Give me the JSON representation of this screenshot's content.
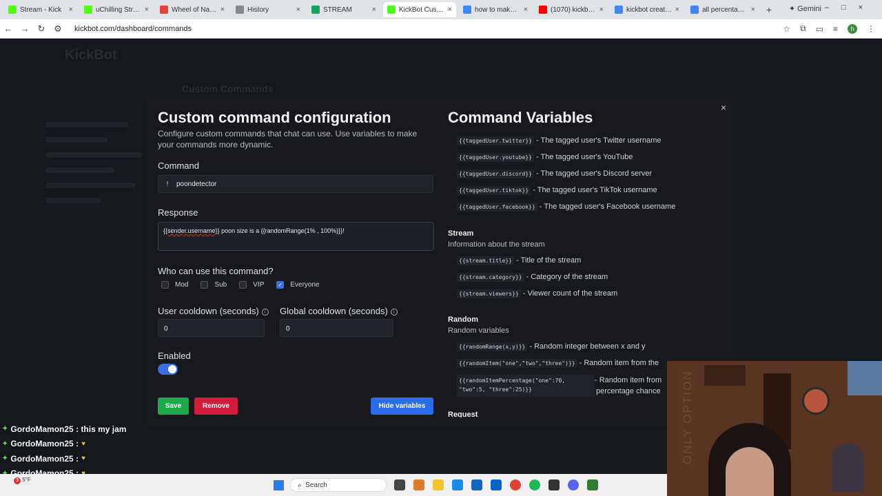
{
  "browser": {
    "tabs": [
      {
        "title": "Stream - Kick",
        "color": "#53fc18",
        "active": false
      },
      {
        "title": "uChilling Stream",
        "color": "#53fc18",
        "active": false
      },
      {
        "title": "Wheel of Names",
        "color": "#e0453c",
        "active": false
      },
      {
        "title": "History",
        "color": "#888888",
        "active": false
      },
      {
        "title": "STREAM",
        "color": "#1aa260",
        "active": false
      },
      {
        "title": "KickBot Custom",
        "color": "#53fc18",
        "active": true
      },
      {
        "title": "how to make cu",
        "color": "#4285f4",
        "active": false
      },
      {
        "title": "(1070) kickbot c",
        "color": "#ff0000",
        "active": false
      },
      {
        "title": "kickbot create n",
        "color": "#4285f4",
        "active": false
      },
      {
        "title": "all percentages",
        "color": "#4285f4",
        "active": false
      }
    ],
    "new_tab": "+",
    "gemini_label": "Gemini",
    "url": "kickbot.com/dashboard/commands",
    "profile_letter": "h"
  },
  "background_page": {
    "logo": "KickBot",
    "title": "Custom Commands"
  },
  "modal": {
    "title": "Custom command configuration",
    "description": "Configure custom commands that chat can use. Use variables to make your commands more dynamic.",
    "command_label": "Command",
    "command_prefix": "!",
    "command_value": "poondetector",
    "response_label": "Response",
    "response_part1": "{{sender.username}}",
    "response_part2": " poon size is a {{randomRange(1% , 100%)}}!",
    "who_label": "Who can use this command?",
    "roles": [
      {
        "label": "Mod",
        "checked": false
      },
      {
        "label": "Sub",
        "checked": false
      },
      {
        "label": "VIP",
        "checked": false
      },
      {
        "label": "Everyone",
        "checked": true
      }
    ],
    "user_cooldown_label": "User cooldown (seconds)",
    "user_cooldown_value": "0",
    "global_cooldown_label": "Global cooldown (seconds)",
    "global_cooldown_value": "0",
    "enabled_label": "Enabled",
    "enabled": true,
    "save_label": "Save",
    "remove_label": "Remove",
    "hide_vars_label": "Hide variables",
    "close_label": "×"
  },
  "variables": {
    "title": "Command Variables",
    "tagged": [
      {
        "code": "{{taggedUser.twitter}}",
        "desc": " - The tagged user's Twitter username"
      },
      {
        "code": "{{taggedUser.youtube}}",
        "desc": " - The tagged user's YouTube"
      },
      {
        "code": "{{taggedUser.discord}}",
        "desc": " - The tagged user's Discord server"
      },
      {
        "code": "{{taggedUser.tiktok}}",
        "desc": " - The tagged user's TikTok username"
      },
      {
        "code": "{{taggedUser.facebook}}",
        "desc": " - The tagged user's Facebook username"
      }
    ],
    "stream_title": "Stream",
    "stream_desc": "Information about the stream",
    "stream": [
      {
        "code": "{{stream.title}}",
        "desc": " - Title of the stream"
      },
      {
        "code": "{{stream.category}}",
        "desc": " - Category of the stream"
      },
      {
        "code": "{{stream.viewers}}",
        "desc": " - Viewer count of the stream"
      }
    ],
    "random_title": "Random",
    "random_desc": "Random variables",
    "random": [
      {
        "code": "{{randomRange(x,y)}}",
        "desc": " - Random integer between x and y"
      },
      {
        "code": "{{randomItem(\"one\",\"two\",\"three\")}}",
        "desc": " - Random item from the"
      },
      {
        "code": "{{randomItemPercentage(\"one\":70,",
        "code2": "\"two\":5, \"three\":25)}}",
        "desc": " - Random item from",
        "desc2": "percentage chance"
      }
    ],
    "request_title": "Request"
  },
  "chat": [
    {
      "user": "GordoMamon25",
      "msg": ": this my jam"
    },
    {
      "user": "GordoMamon25",
      "msg": ":"
    },
    {
      "user": "GordoMamon25",
      "msg": ":"
    },
    {
      "user": "GordoMamon25",
      "msg": ":"
    },
    {
      "user": "GordoMamon25",
      "msg": ":"
    }
  ],
  "webcam": {
    "watermark": "ONLY OPTION"
  },
  "taskbar": {
    "weather_temp": "5°F",
    "notif_count": "3",
    "search_placeholder": "Search"
  }
}
